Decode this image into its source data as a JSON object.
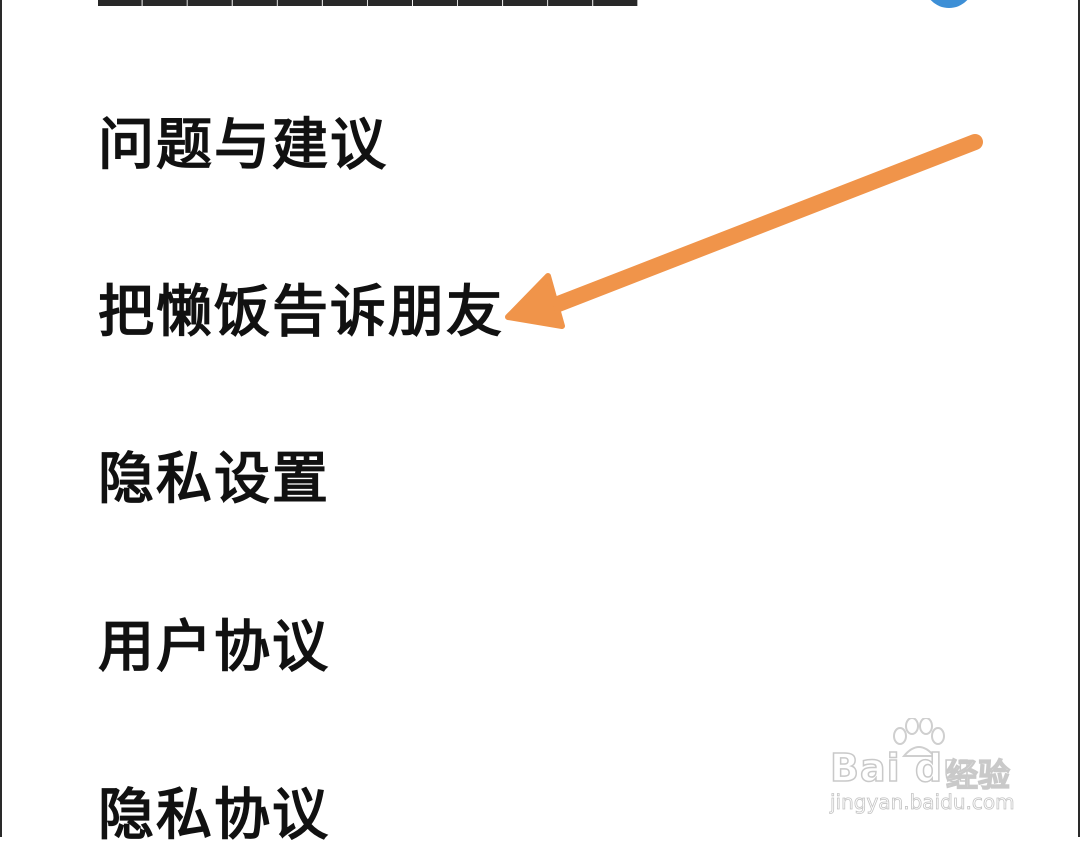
{
  "menu": {
    "items": [
      {
        "label": "问题与建议"
      },
      {
        "label": "把懒饭告诉朋友"
      },
      {
        "label": "隐私设置"
      },
      {
        "label": "用户协议"
      },
      {
        "label": "隐私协议"
      }
    ]
  },
  "annotation": {
    "arrow_color": "#f0944a"
  },
  "accent_colors": {
    "toggle": "#3d8fd6"
  },
  "watermark": {
    "logo": "Bai du",
    "brand": "经验",
    "url": "jingyan.baidu.com"
  }
}
